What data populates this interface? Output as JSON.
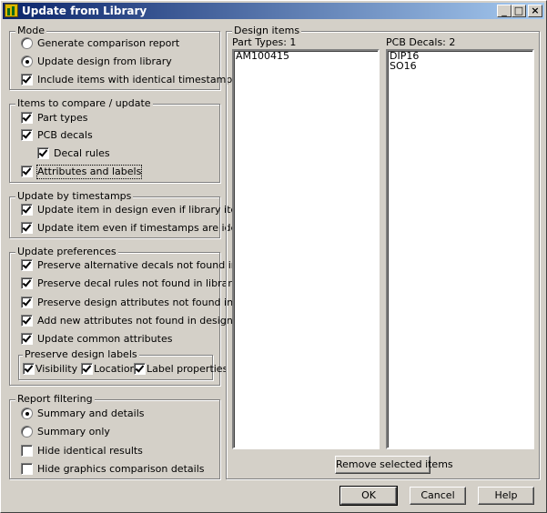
{
  "window": {
    "title": "Update from Library"
  },
  "titlebar_buttons": {
    "minimize": "_",
    "maximize": "□",
    "close": "×"
  },
  "mode": {
    "legend": "Mode",
    "options": [
      {
        "label": "Generate comparison report",
        "checked": false
      },
      {
        "label": "Update design from library",
        "checked": true
      }
    ],
    "include_identical": {
      "label": "Include items with identical timestamps",
      "checked": true
    }
  },
  "items_compare": {
    "legend": "Items to compare / update",
    "items": [
      {
        "label": "Part types",
        "checked": true
      },
      {
        "label": "PCB decals",
        "checked": true
      },
      {
        "label": "Decal rules",
        "checked": true
      },
      {
        "label": "Attributes and labels",
        "checked": true
      }
    ]
  },
  "timestamps": {
    "legend": "Update by timestamps",
    "items": [
      {
        "label": "Update item in design even if library item is older",
        "checked": true
      },
      {
        "label": "Update item even if timestamps are identical",
        "checked": true
      }
    ]
  },
  "preferences": {
    "legend": "Update preferences",
    "items": [
      {
        "label": "Preserve alternative decals not found in library",
        "checked": true
      },
      {
        "label": "Preserve decal rules not found in library",
        "checked": true
      },
      {
        "label": "Preserve design attributes not found in library",
        "checked": true
      },
      {
        "label": "Add new attributes not found in design",
        "checked": true
      },
      {
        "label": "Update common attributes",
        "checked": true
      }
    ],
    "labels_group": {
      "legend": "Preserve design labels",
      "items": [
        {
          "label": "Visibility",
          "checked": true
        },
        {
          "label": "Location",
          "checked": true
        },
        {
          "label": "Label properties",
          "checked": true
        }
      ]
    }
  },
  "report": {
    "legend": "Report filtering",
    "radios": [
      {
        "label": "Summary and details",
        "checked": true
      },
      {
        "label": "Summary only",
        "checked": false
      }
    ],
    "checks": [
      {
        "label": "Hide identical results",
        "checked": false
      },
      {
        "label": "Hide graphics comparison details",
        "checked": false
      }
    ]
  },
  "design_items": {
    "legend": "Design items",
    "part_types": {
      "header": "Part Types: 1",
      "items": [
        "AM100415"
      ]
    },
    "pcb_decals": {
      "header": "PCB Decals: 2",
      "items": [
        "DIP16",
        "SO16"
      ]
    },
    "remove_button": "Remove selected items"
  },
  "buttons": {
    "ok": "OK",
    "cancel": "Cancel",
    "help": "Help"
  }
}
